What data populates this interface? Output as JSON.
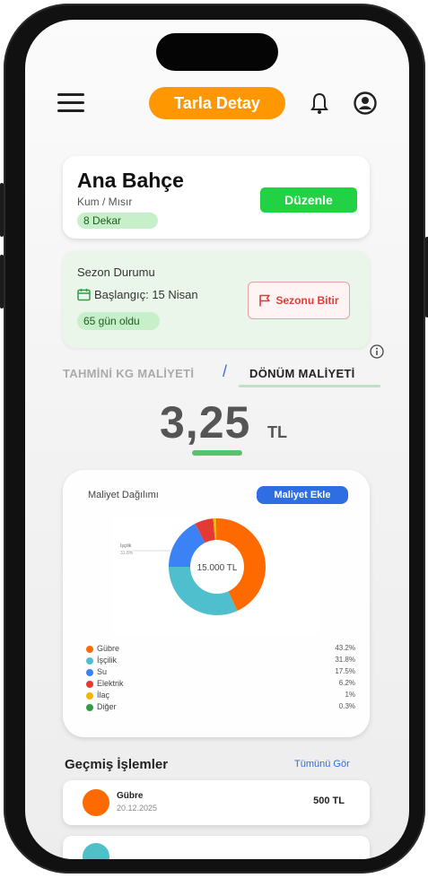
{
  "header": {
    "title": "Tarla Detay"
  },
  "field": {
    "name": "Ana Bahçe",
    "type": "Kum / Mısır",
    "area": "8 Dekar",
    "edit_label": "Düzenle"
  },
  "season": {
    "title": "Sezon Durumu",
    "start": "Başlangıç: 15 Nisan",
    "days": "65 gün oldu",
    "finish_label": "Sezonu Bitir"
  },
  "tabs": {
    "kg": "TAHMİNİ KG MALİYETİ",
    "separator": "/",
    "donum": "DÖNÜM MALİYETİ"
  },
  "cost": {
    "value": "3,25",
    "unit": "TL"
  },
  "distribution": {
    "title": "Maliyet Dağılımı",
    "add_label": "Maliyet Ekle",
    "center_label": "15.000 TL",
    "callout_label": "İşçilik",
    "callout_pct": "31.8%"
  },
  "chart_data": {
    "type": "pie",
    "total": "15.000 TL",
    "slices": [
      {
        "label": "Gübre",
        "value": 43.2,
        "color": "#ff6a00"
      },
      {
        "label": "İşçilik",
        "value": 31.8,
        "color": "#4fbfcd"
      },
      {
        "label": "Su",
        "value": 17.5,
        "color": "#3b82f6"
      },
      {
        "label": "Elektrik",
        "value": 6.2,
        "color": "#e53935"
      },
      {
        "label": "İlaç",
        "value": 1,
        "color": "#f5b400"
      },
      {
        "label": "Diğer",
        "value": 0.3,
        "color": "#2e9e44"
      }
    ]
  },
  "legend": [
    {
      "label": "Gübre",
      "pct": "43.2%",
      "color": "#ff6a00"
    },
    {
      "label": "İşçilik",
      "pct": "31.8%",
      "color": "#4fbfcd"
    },
    {
      "label": "Su",
      "pct": "17.5%",
      "color": "#3b82f6"
    },
    {
      "label": "Elektrik",
      "pct": "6.2%",
      "color": "#e53935"
    },
    {
      "label": "İlaç",
      "pct": "1%",
      "color": "#f5b400"
    },
    {
      "label": "Diğer",
      "pct": "0.3%",
      "color": "#2e9e44"
    }
  ],
  "history": {
    "title": "Geçmiş İşlemler",
    "see_all": "Tümünü Gör",
    "items": [
      {
        "name": "Gübre",
        "date": "20.12.2025",
        "amount": "500 TL",
        "color": "#ff6a00"
      }
    ]
  },
  "colors": {
    "accent": "#ff9800",
    "primary": "#2f6ee2",
    "success": "#22d244",
    "danger": "#e53935"
  },
  "icons": {
    "menu": "hamburger-icon",
    "notifications": "bell-icon",
    "profile": "user-icon",
    "calendar": "calendar-icon",
    "flag": "flag-icon",
    "info": "info-icon"
  }
}
